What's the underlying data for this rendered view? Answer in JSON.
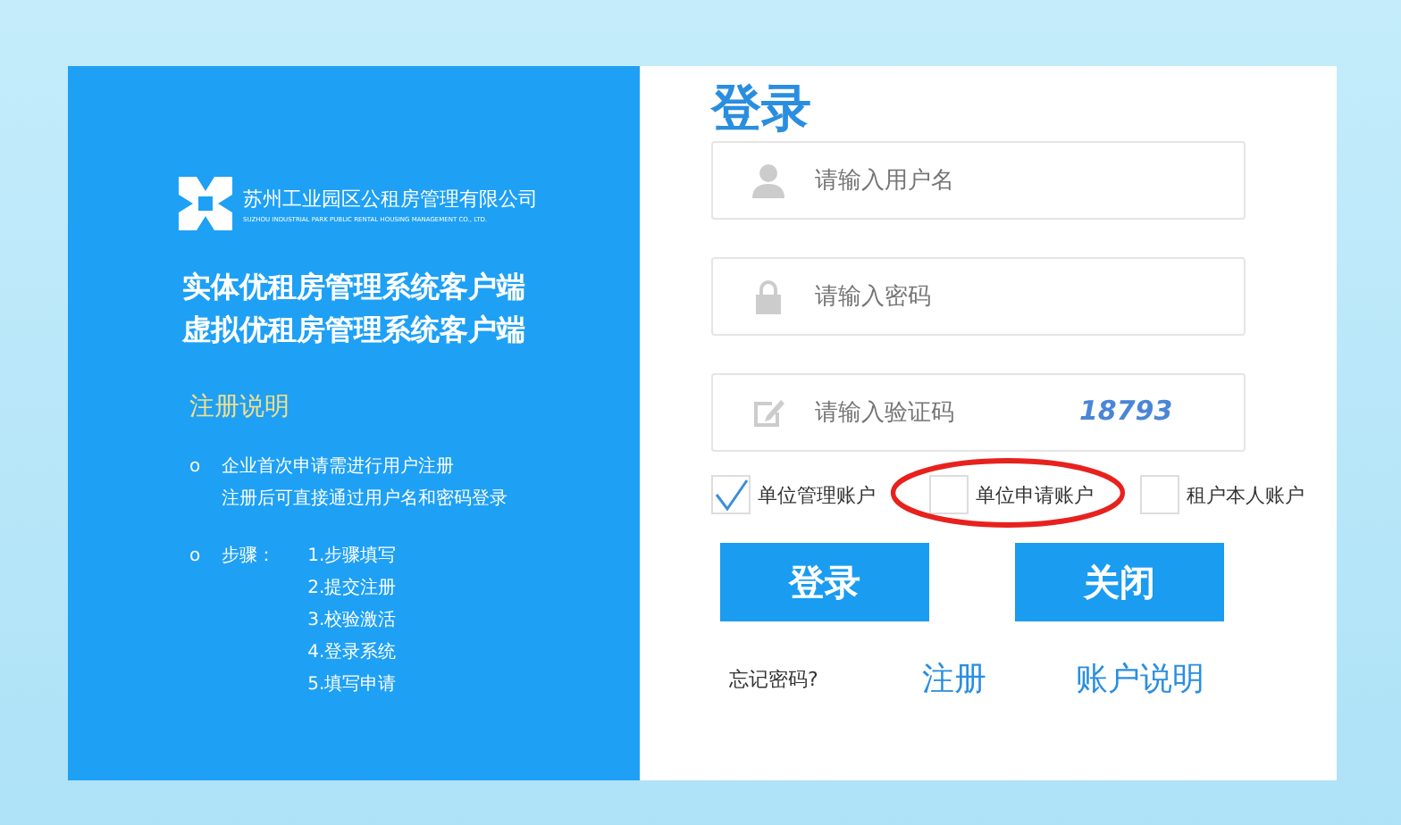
{
  "brand": {
    "name": "苏州工业园区公租房管理有限公司",
    "subtitle": "SUZHOU INDUSTRIAL PARK PUBLIC RENTAL HOUSING MANAGEMENT CO., LTD."
  },
  "systems": [
    "实体优租房管理系统客户端",
    "虚拟优租房管理系统客户端"
  ],
  "notes": {
    "title": "注册说明",
    "intro_bullet": "o",
    "steps_bullet": "o",
    "intro": [
      "企业首次申请需进行用户注册",
      "注册后可直接通过用户名和密码登录"
    ],
    "steps_label": "步骤：",
    "steps": [
      "1.步骤填写",
      "2.提交注册",
      "3.校验激活",
      "4.登录系统",
      "5.填写申请"
    ]
  },
  "login": {
    "title": "登录",
    "fields": [
      {
        "kind": "user",
        "placeholder": "请输入用户名"
      },
      {
        "kind": "lock",
        "placeholder": "请输入密码"
      },
      {
        "kind": "captcha",
        "placeholder": "请输入验证码",
        "captcha": "18793"
      }
    ],
    "account_types": [
      {
        "label": "单位管理账户",
        "checked": true,
        "highlighted": false
      },
      {
        "label": "单位申请账户",
        "checked": false,
        "highlighted": true
      },
      {
        "label": "租户本人账户",
        "checked": false,
        "highlighted": false
      }
    ],
    "buttons": [
      "登录",
      "关闭"
    ],
    "links": [
      "忘记密码?",
      "注册",
      "账户说明"
    ]
  }
}
